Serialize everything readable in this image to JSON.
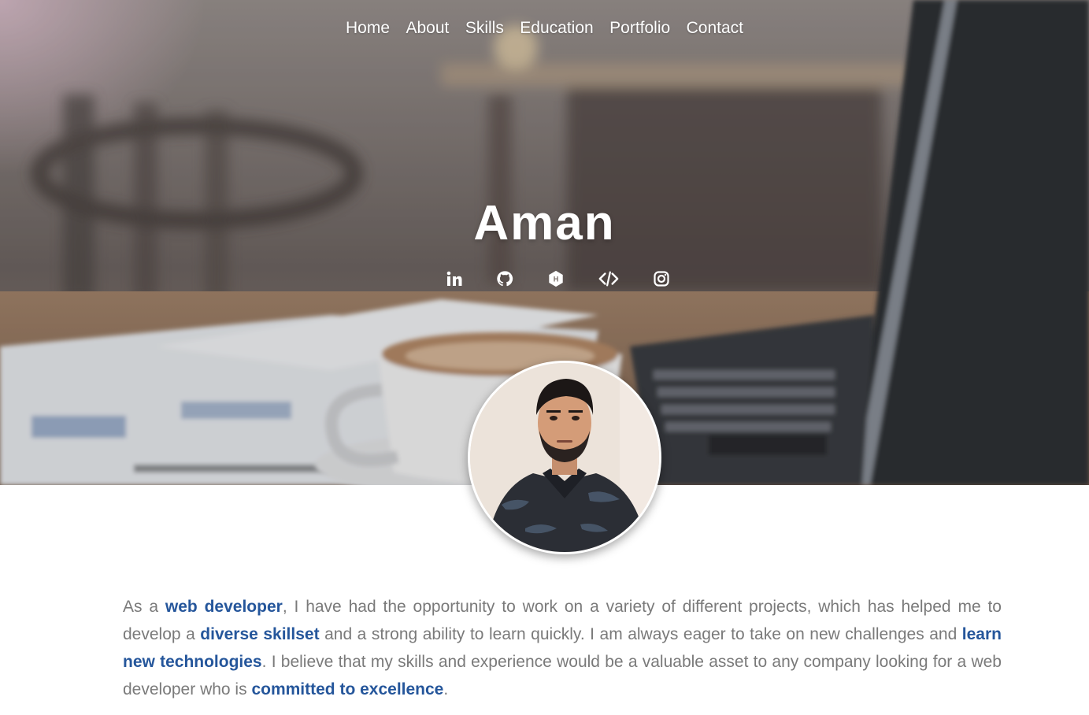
{
  "nav": {
    "items": [
      {
        "label": "Home"
      },
      {
        "label": "About"
      },
      {
        "label": "Skills"
      },
      {
        "label": "Education"
      },
      {
        "label": "Portfolio"
      },
      {
        "label": "Contact"
      }
    ]
  },
  "hero": {
    "name": "Aman",
    "socials": [
      {
        "icon": "linkedin-icon"
      },
      {
        "icon": "github-icon"
      },
      {
        "icon": "hashnode-icon"
      },
      {
        "icon": "code-icon"
      },
      {
        "icon": "instagram-icon"
      }
    ]
  },
  "about": {
    "p1": "As a ",
    "h1": "web developer",
    "p2": ", I have had the opportunity to work on a variety of different projects, which has helped me to develop a ",
    "h2": "diverse skillset",
    "p3": " and a strong ability to learn quickly. I am always eager to take on new challenges and ",
    "h3": "learn new technologies",
    "p4": ". I believe that my skills and experience would be a valuable asset to any company looking for a web developer who is ",
    "h4": "committed to excellence",
    "p5": "."
  },
  "colors": {
    "accent": "#25569b",
    "body_text": "#7a7a7a",
    "hero_text": "#ffffff"
  }
}
